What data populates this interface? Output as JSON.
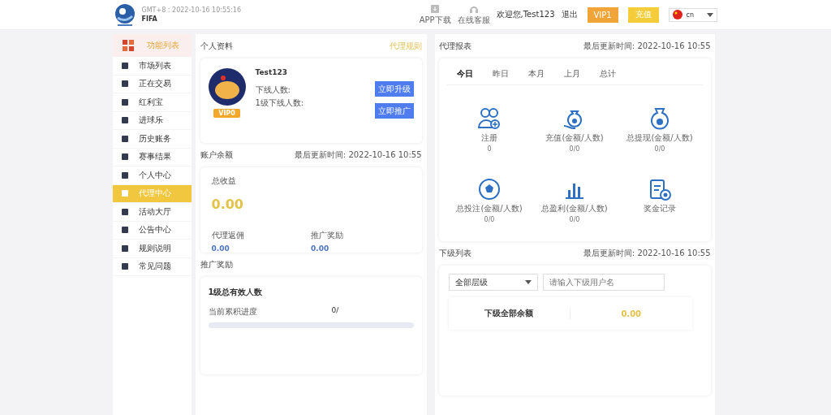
{
  "header": {
    "clock": "GMT+8 : 2022-10-16 10:55:16",
    "brand": "FIFA",
    "links": [
      {
        "kind": "download",
        "label": "APP下载"
      },
      {
        "kind": "support",
        "label": "在线客服"
      }
    ],
    "welcome": "欢迎您,Test123",
    "logout": "退出",
    "vip_button": "VIP1",
    "deposit_button": "充值",
    "language": "cn"
  },
  "sidebar": {
    "title": "功能列表",
    "items": [
      {
        "label": "市场列表",
        "selected": false
      },
      {
        "label": "正在交易",
        "selected": false
      },
      {
        "label": "红利宝",
        "selected": false
      },
      {
        "label": "进球乐",
        "selected": false
      },
      {
        "label": "历史账务",
        "selected": false
      },
      {
        "label": "赛事结果",
        "selected": false
      },
      {
        "label": "个人中心",
        "selected": false
      },
      {
        "label": "代理中心",
        "selected": true
      },
      {
        "label": "活动大厅",
        "selected": false
      },
      {
        "label": "公告中心",
        "selected": false
      },
      {
        "label": "规则说明",
        "selected": false
      },
      {
        "label": "常见问题",
        "selected": false
      }
    ]
  },
  "profile": {
    "title": "个人资料",
    "rules_link": "代理规则",
    "username": "Test123",
    "vip": "VIP0",
    "lines": [
      "下线人数:",
      "1级下线人数:"
    ],
    "buttons": [
      "立即升级",
      "立即推广"
    ]
  },
  "balance": {
    "title": "账户余额",
    "updated": "最后更新时间: 2022-10-16 10:55",
    "total_label": "总收益",
    "total": "0.00",
    "items": [
      {
        "label": "代理返佣",
        "value": "0.00"
      },
      {
        "label": "推广奖励",
        "value": "0.00"
      }
    ]
  },
  "promotion": {
    "title": "推广奖励",
    "card_title": "1级总有效人数",
    "progress_label": "当前累积进度",
    "progress_value": "0/",
    "level": 0
  },
  "report": {
    "title": "代理报表",
    "updated": "最后更新时间: 2022-10-16 10:55",
    "tabs": [
      {
        "label": "今日",
        "selected": true
      },
      {
        "label": "昨日",
        "selected": false
      },
      {
        "label": "本月",
        "selected": false
      },
      {
        "label": "上月",
        "selected": false
      },
      {
        "label": "总计",
        "selected": false
      }
    ],
    "stats": [
      {
        "kind": "register",
        "label": "注册",
        "value": "0"
      },
      {
        "kind": "deposit",
        "label": "充值(金额/人数)",
        "value": "0/0"
      },
      {
        "kind": "withdraw",
        "label": "总提现(金额/人数)",
        "value": "0/0"
      },
      {
        "kind": "bet",
        "label": "总投注(金额/人数)",
        "value": "0/0"
      },
      {
        "kind": "profit",
        "label": "总盈利(金额/人数)",
        "value": "0/0"
      },
      {
        "kind": "bonus",
        "label": "奖金记录"
      }
    ]
  },
  "subordinates": {
    "title": "下级列表",
    "updated": "最后更新时间: 2022-10-16 10:55",
    "level_select": "全部层级",
    "search": {
      "placeholder": "请输入下级用户名"
    },
    "total_label": "下级全部余额",
    "total": "0.00"
  }
}
